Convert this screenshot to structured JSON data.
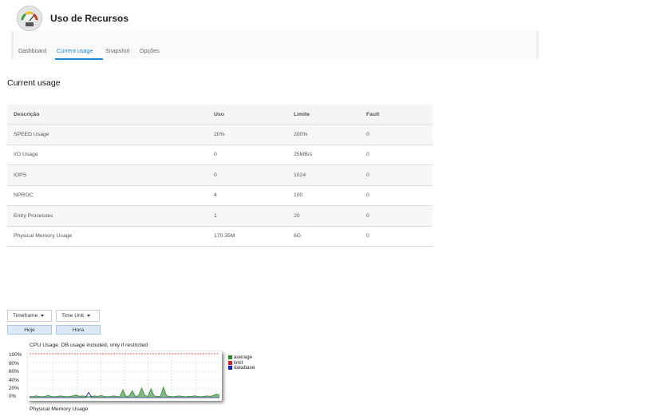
{
  "app": {
    "title": "Uso de Recursos",
    "icon": "gauge-icon"
  },
  "tabs": [
    {
      "label": "Dashboard",
      "active": false
    },
    {
      "label": "Current usage",
      "active": true
    },
    {
      "label": "Snapshot",
      "active": false
    },
    {
      "label": "Opções",
      "active": false
    }
  ],
  "page_title": "Current usage",
  "table": {
    "headers": [
      "Descrição",
      "Uso",
      "Limite",
      "Fault"
    ],
    "rows": [
      [
        "SPEED Usage",
        "20%",
        "200%",
        "0"
      ],
      [
        "I/O Usage",
        "0",
        "25MB/s",
        "0"
      ],
      [
        "IOPS",
        "0",
        "1024",
        "0"
      ],
      [
        "NPROC",
        "4",
        "100",
        "0"
      ],
      [
        "Entry Processes",
        "1",
        "20",
        "0"
      ],
      [
        "Physical Memory Usage",
        "170.35M",
        "6G",
        "0"
      ]
    ]
  },
  "controls": {
    "timeframe_label": "Timeframe",
    "timeunit_label": "Time Unit",
    "hoje_label": "Hoje",
    "hora_label": "Hora"
  },
  "cpu_chart": {
    "title": "CPU Usage. DB usage included, only if restricted",
    "y_ticks": [
      "100%",
      "80%",
      "60%",
      "40%",
      "20%",
      "0%"
    ],
    "legend": [
      {
        "name": "average",
        "color": "#2e8b2e"
      },
      {
        "name": "limit",
        "color": "#d02020"
      },
      {
        "name": "database",
        "color": "#2020c8"
      }
    ]
  },
  "chart_data": {
    "type": "area",
    "title": "CPU Usage. DB usage included, only if restricted",
    "ylim": [
      0,
      100
    ],
    "y_unit": "%",
    "grid": true,
    "legend_position": "right",
    "series": [
      {
        "name": "average",
        "values": [
          3,
          2,
          4,
          3,
          2,
          3,
          5,
          3,
          2,
          3,
          4,
          3,
          2,
          3,
          4,
          6,
          3,
          4,
          3,
          2,
          3,
          4,
          3,
          5,
          3,
          2,
          3,
          4,
          3,
          2,
          18,
          3,
          4,
          16,
          3,
          4,
          22,
          5,
          3,
          20,
          4,
          3,
          3,
          24,
          4,
          3,
          2,
          3,
          4,
          3,
          2,
          3,
          3,
          4,
          3,
          2,
          3,
          4,
          3,
          5,
          8,
          6
        ]
      },
      {
        "name": "limit",
        "values": [
          100,
          100,
          100,
          100,
          100,
          100,
          100,
          100,
          100,
          100,
          100,
          100,
          100,
          100,
          100,
          100,
          100,
          100,
          100,
          100,
          100,
          100,
          100,
          100,
          100,
          100,
          100,
          100,
          100,
          100,
          100,
          100,
          100,
          100,
          100,
          100,
          100,
          100,
          100,
          100,
          100,
          100,
          100,
          100,
          100,
          100,
          100,
          100,
          100,
          100,
          100,
          100,
          100,
          100,
          100,
          100,
          100,
          100,
          100,
          100,
          100,
          100
        ]
      },
      {
        "name": "database",
        "values": [
          0,
          0,
          0,
          0,
          0,
          0,
          0,
          0,
          0,
          0,
          0,
          0,
          0,
          0,
          0,
          0,
          0,
          0,
          0,
          12,
          0,
          0,
          0,
          0,
          0,
          0,
          0,
          0,
          0,
          0,
          0,
          0,
          0,
          0,
          0,
          0,
          0,
          0,
          0,
          0,
          0,
          0,
          0,
          0,
          0,
          0,
          0,
          0,
          0,
          0,
          0,
          0,
          0,
          0,
          0,
          0,
          0,
          0,
          0,
          0,
          0,
          0
        ]
      }
    ]
  },
  "memory_chart": {
    "title": "Physical Memory Usage"
  }
}
